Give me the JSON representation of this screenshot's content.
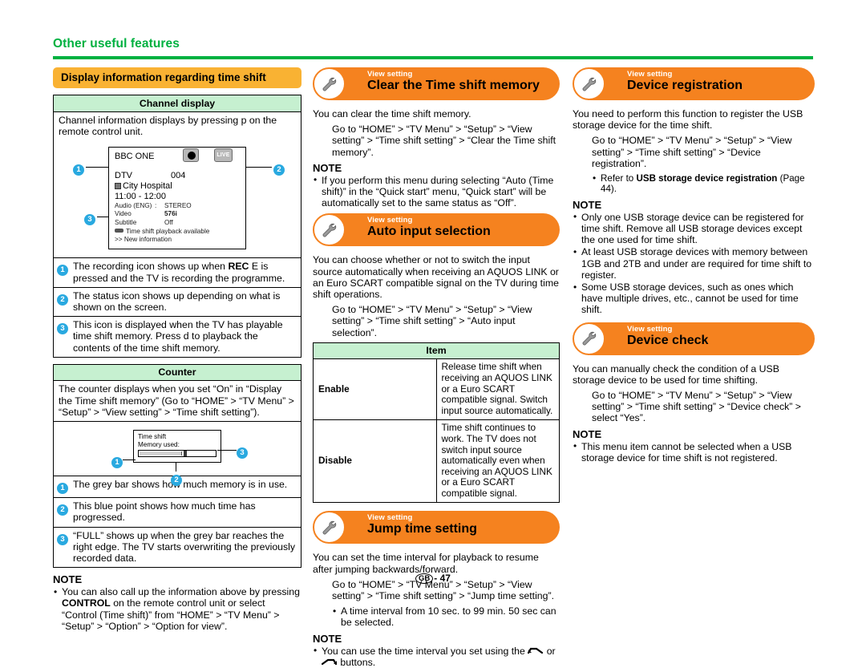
{
  "header": {
    "chapter_title": "Other useful features",
    "accent_color": "#00b140"
  },
  "footer": {
    "region_code": "GB",
    "separator": "-",
    "page_number": "47"
  },
  "left_column": {
    "section_banner": "Display information regarding time shift",
    "channel_table": {
      "header": "Channel display",
      "intro": "Channel information displays by pressing p on the remote control unit.",
      "tv_mock": {
        "channel_name": "BBC ONE",
        "rec_icon": "record-dot-icon",
        "live_badge": "LIVE",
        "source": "DTV",
        "channel_number": "004",
        "programme": "City Hospital",
        "time": "11:00 - 12:00",
        "audio_key": "Audio (ENG)",
        "audio_colon": ":",
        "audio_value": "STEREO",
        "video_key": "Video",
        "video_value": "576i",
        "subtitle_key": "Subtitle",
        "subtitle_value": "Off",
        "timeshift_line": "Time shift playback available",
        "new_info_line": ">> New information",
        "callout_1": "1",
        "callout_2": "2",
        "callout_3": "3"
      },
      "notes": [
        {
          "num": "1",
          "text": "The recording icon shows up when REC E is pressed and the TV is recording the programme.",
          "bold": "REC"
        },
        {
          "num": "2",
          "text": "The status icon shows up depending on what is shown on the screen.",
          "bold": ""
        },
        {
          "num": "3",
          "text": "This icon is displayed when the TV has playable time shift memory. Press d to playback the contents of the time shift memory.",
          "bold": ""
        }
      ]
    },
    "counter_table": {
      "header": "Counter",
      "intro": "The counter displays when you set “On” in “Display the Time shift memory” (Go to “HOME” > “TV Menu” > “Setup” > “View setting” > “Time shift setting”).",
      "counter_mock": {
        "line1": "Time shift",
        "line2": "Memory used:",
        "callout_1": "1",
        "callout_2": "2",
        "callout_3": "3"
      },
      "notes": [
        {
          "num": "1",
          "text": "The grey bar shows how much memory is in use."
        },
        {
          "num": "2",
          "text": "This blue point shows how much time has progressed."
        },
        {
          "num": "3",
          "text": "“FULL” shows up when the grey bar reaches the right edge. The TV starts overwriting the previously recorded data."
        }
      ]
    },
    "note": {
      "heading": "NOTE",
      "items_html": [
        "You can also call up the information above by pressing <b>CONTROL</b> on the remote control unit or select “Control (Time shift)” from “HOME” > “TV Menu” > “Setup” > “Option” > “Option for view”."
      ]
    }
  },
  "mid_column": {
    "clear_memory": {
      "eyebrow": "View setting",
      "title": "Clear the Time shift memory",
      "icon": "wrench-icon",
      "intro": "You can clear the time shift memory.",
      "path": "Go to “HOME” > “TV Menu” > “Setup” > “View setting” > “Time shift setting” > “Clear the Time shift memory”.",
      "note_heading": "NOTE",
      "note_items": [
        "If you perform this menu during selecting “Auto (Time shift)” in the “Quick start” menu, “Quick start” will be automatically set to the same status as “Off”."
      ]
    },
    "auto_input": {
      "eyebrow": "View setting",
      "title": "Auto input selection",
      "icon": "wrench-icon",
      "intro": "You can choose whether or not to switch the input source automatically when receiving an AQUOS LINK or an Euro SCART compatible signal on the TV during time shift operations.",
      "path": "Go to “HOME” > “TV Menu” > “Setup” > “View setting” > “Time shift setting” > “Auto input selection”.",
      "table": {
        "header": "Item",
        "rows": [
          {
            "key": "Enable",
            "value": "Release time shift when receiving an AQUOS LINK or a Euro SCART compatible signal. Switch input source automatically."
          },
          {
            "key": "Disable",
            "value": "Time shift continues to work. The TV does not switch input source automatically even when receiving an AQUOS LINK or a Euro SCART compatible signal."
          }
        ]
      }
    },
    "jump_time": {
      "eyebrow": "View setting",
      "title": "Jump time setting",
      "icon": "wrench-icon",
      "intro": "You can set the time interval for playback to resume after jumping backwards/forward.",
      "path": "Go to “HOME” > “TV Menu” > “Setup” > “View setting” > “Time shift setting” > “Jump time setting”.",
      "sub_bullets": [
        "A time interval from 10 sec. to 99 min. 50 sec can be selected."
      ],
      "note_heading": "NOTE",
      "note_prefix": "You can use the time interval you set using the",
      "note_mid": "or",
      "note_suffix": "buttons."
    }
  },
  "right_column": {
    "device_registration": {
      "eyebrow": "View setting",
      "title": "Device registration",
      "icon": "wrench-icon",
      "intro": "You need to perform this function to register the USB storage device for the time shift.",
      "path": "Go to “HOME” > “TV Menu” > “Setup” > “View setting” > “Time shift setting” > “Device registration”.",
      "sub_bullet_html": "Refer to <b>USB storage device registration</b> (Page 44).",
      "note_heading": "NOTE",
      "note_items": [
        "Only one USB storage device can be registered for time shift. Remove all USB storage devices except the one used for time shift.",
        "At least USB storage devices with memory between 1GB and 2TB and under are required for time shift to register.",
        "Some USB storage devices, such as ones which have multiple drives, etc., cannot be used for time shift."
      ]
    },
    "device_check": {
      "eyebrow": "View setting",
      "title": "Device check",
      "icon": "wrench-icon",
      "intro": "You can manually check the condition of a USB storage device to be used for time shifting.",
      "path": "Go to “HOME” > “TV Menu” > “Setup” > “View setting” > “Time shift setting” > “Device check” > select “Yes”.",
      "note_heading": "NOTE",
      "note_items": [
        "This menu item cannot be selected when a USB storage device for time shift is not registered."
      ]
    }
  }
}
